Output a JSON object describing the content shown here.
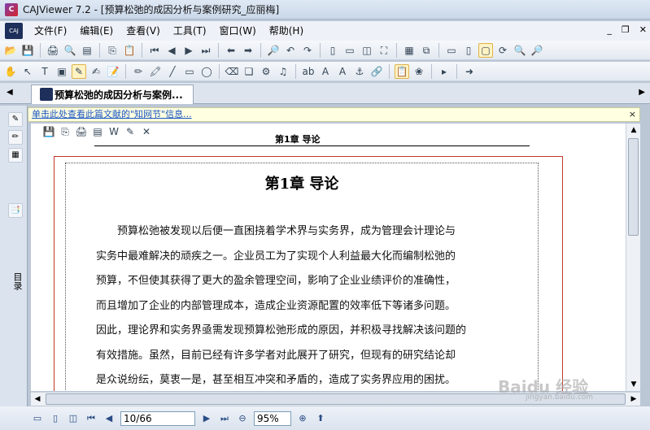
{
  "window": {
    "title": "CAJViewer 7.2 - [预算松弛的成因分析与案例研究_应丽梅]"
  },
  "menu": {
    "items": [
      "文件(F)",
      "编辑(E)",
      "查看(V)",
      "工具(T)",
      "窗口(W)",
      "帮助(H)"
    ]
  },
  "tab": {
    "label": "预算松弛的成因分析与案例..."
  },
  "infobar": {
    "text": "单击此处查看此篇文献的\"知网节\"信息...",
    "close": "×"
  },
  "sidebar": {
    "label": "目录"
  },
  "document": {
    "running_head": "第1章    导论",
    "chapter_title": "第1章 导论",
    "lines": [
      "预算松弛被发现以后便一直困挠着学术界与实务界，成为管理会计理论与",
      "实务中最难解决的顽疾之一。企业员工为了实现个人利益最大化而编制松弛的",
      "预算，不但使其获得了更大的盈余管理空间，影响了企业业绩评价的准确性，",
      "而且增加了企业的内部管理成本，造成企业资源配置的效率低下等诸多问题。",
      "因此，理论界和实务界亟需发现预算松弛形成的原因，并积极寻找解决该问题的",
      "有效措施。虽然，目前已经有许多学者对此展开了研究，但现有的研究结论却",
      "是众说纷纭，莫衷一是，甚至相互冲突和矛盾的，造成了实务界应用的困扰。"
    ]
  },
  "status": {
    "page": "10/66",
    "zoom": "95%"
  },
  "watermark": {
    "text": "Baidu 经验",
    "sub": "jingyan.baidu.com"
  }
}
